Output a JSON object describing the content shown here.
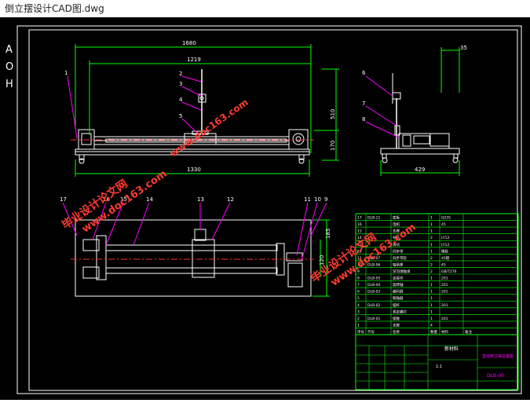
{
  "window": {
    "title": "倒立摆设计CAD图.dwg"
  },
  "ucs": {
    "letters": [
      "A",
      "O",
      "H"
    ]
  },
  "front_view": {
    "dims": {
      "overall": "1680",
      "upper": "1219",
      "base": "1330",
      "height": "510",
      "low": "170"
    },
    "balloons": [
      "1",
      "2",
      "3",
      "4",
      "5"
    ]
  },
  "side_view": {
    "dims": {
      "top": "35",
      "base": "429"
    },
    "balloons": [
      "6",
      "7",
      "8"
    ]
  },
  "plan_view": {
    "balloons": [
      "17",
      "16",
      "15",
      "14",
      "13",
      "12",
      "11",
      "10",
      "9"
    ],
    "dims": {
      "a": "185",
      "b": "120"
    }
  },
  "bom": {
    "rows": [
      [
        "17",
        "DLB-11",
        "底板",
        "1",
        "Q235",
        ""
      ],
      [
        "16",
        "",
        "电机",
        "1",
        "45",
        ""
      ],
      [
        "15",
        "",
        "支座",
        "1",
        "",
        ""
      ],
      [
        "14",
        "",
        "导轨",
        "2",
        "LY12",
        ""
      ],
      [
        "13",
        "",
        "滑块",
        "1",
        "LY12",
        ""
      ],
      [
        "12",
        "",
        "同步带",
        "1",
        "橡胶",
        ""
      ],
      [
        "11",
        "DLB-07",
        "同步带轮",
        "2",
        "45钢",
        ""
      ],
      [
        "10",
        "DLB-06",
        "轴承座",
        "2",
        "45",
        ""
      ],
      [
        "9",
        "",
        "深沟球轴承",
        "2",
        "GB/T276",
        ""
      ],
      [
        "8",
        "DLB-05",
        "连接块",
        "1",
        "201",
        ""
      ],
      [
        "7",
        "DLB-04",
        "旋转轴",
        "1",
        "201",
        ""
      ],
      [
        "6",
        "DLB-03",
        "编码器",
        "1",
        "201",
        ""
      ],
      [
        "5",
        "",
        "联轴器",
        "1",
        "",
        ""
      ],
      [
        "4",
        "DLB-02",
        "摆杆",
        "1",
        "201",
        ""
      ],
      [
        "3",
        "",
        "紧定螺钉",
        "1",
        "",
        ""
      ],
      [
        "2",
        "DLB-01",
        "摆锤",
        "1",
        "201",
        ""
      ],
      [
        "1",
        "",
        "支脚",
        "4",
        "",
        ""
      ]
    ],
    "header": [
      "序号",
      "代号",
      "名称",
      "数量",
      "材料",
      "备注"
    ],
    "title_block": {
      "material": "新材料",
      "drawing_name": "直线倒立摆总装图",
      "drawing_no": "DLB-00",
      "scale": "1:1"
    }
  },
  "watermarks": [
    {
      "cn": "毕业设计论文网",
      "url": "www.doc163.com"
    },
    {
      "cn": "毕业设计论文网",
      "url": "www.doc163.com"
    },
    {
      "cn": "毕业设计论文网",
      "url": "www.doc163.com"
    }
  ],
  "colors": {
    "background": "#000000",
    "line": "#ffffff",
    "dimension": "#00ff00",
    "leader": "#ff00ff",
    "watermark": "#ff3b30"
  }
}
